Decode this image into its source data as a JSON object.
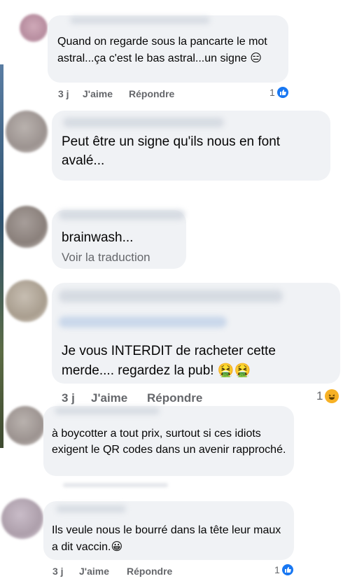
{
  "comments": [
    {
      "text": "Quand on regarde sous la pancarte le mot astral...ça c'est le bas astral...un signe",
      "emoji": "😑",
      "time": "3 j",
      "like_label": "J'aime",
      "reply_label": "Répondre",
      "reaction_count": "1",
      "reaction": "like"
    },
    {
      "text": "Peut être un signe qu'ils nous en font avalé..."
    },
    {
      "text": "brainwash...",
      "translate_label": "Voir la traduction"
    },
    {
      "text": "Je vous INTERDIT de racheter cette merde.... regardez la pub!",
      "emoji": "🤮🤮",
      "time": "3 j",
      "like_label": "J'aime",
      "reply_label": "Répondre",
      "reaction_count": "1",
      "reaction": "haha"
    },
    {
      "text": "à boycotter a tout prix, surtout si ces idiots exigent le QR codes dans un avenir rapproché."
    },
    {
      "text": "Ils veule nous le bourré dans la tête leur maux a dit vaccin.",
      "emoji": "😀",
      "time": "3 j",
      "like_label": "J'aime",
      "reply_label": "Répondre",
      "reaction_count": "1",
      "reaction": "like"
    }
  ],
  "colors": {
    "bubble": "#f0f2f5",
    "meta_text": "#65676b",
    "like_blue": "#1877f2",
    "haha_yellow": "#f7b125"
  }
}
